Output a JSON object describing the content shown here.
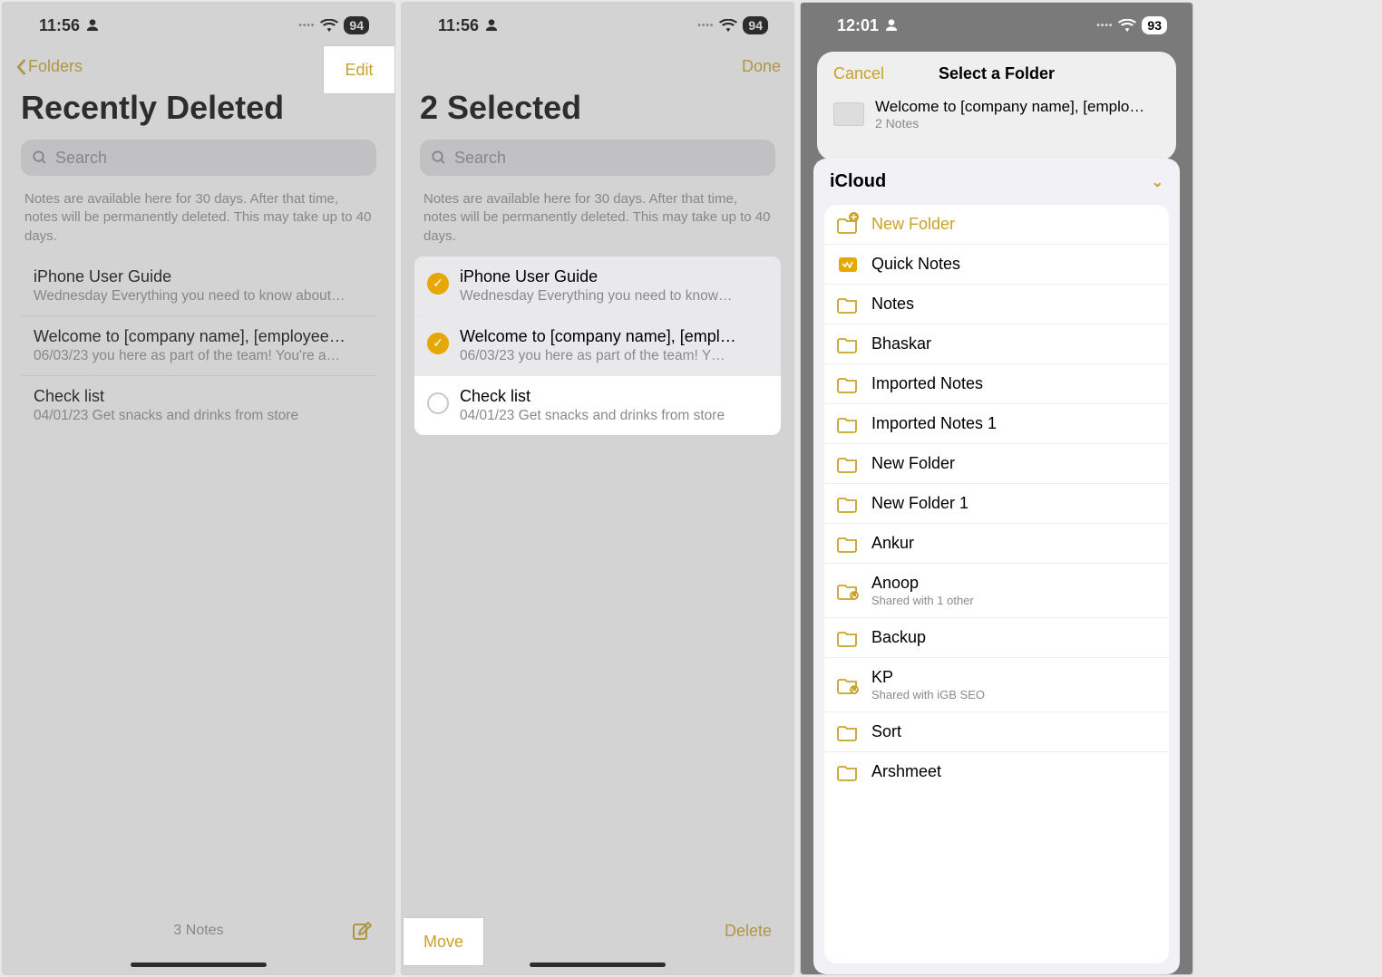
{
  "screen1": {
    "status": {
      "time": "11:56",
      "battery": "94"
    },
    "nav": {
      "back": "Folders",
      "edit": "Edit"
    },
    "title": "Recently Deleted",
    "search_placeholder": "Search",
    "hint": "Notes are available here for 30 days. After that time, notes will be permanently deleted. This may take up to 40 days.",
    "notes": [
      {
        "title": "iPhone User Guide",
        "sub": "Wednesday  Everything you need to know about…"
      },
      {
        "title": "Welcome to [company name], [employee…",
        "sub": "06/03/23  you here as part of the team! You're a…"
      },
      {
        "title": "Check list",
        "sub": "04/01/23  Get snacks and drinks from store"
      }
    ],
    "footer_count": "3 Notes"
  },
  "screen2": {
    "status": {
      "time": "11:56",
      "battery": "94"
    },
    "nav": {
      "done": "Done"
    },
    "title": "2 Selected",
    "search_placeholder": "Search",
    "hint": "Notes are available here for 30 days. After that time, notes will be permanently deleted. This may take up to 40 days.",
    "notes": [
      {
        "title": "iPhone User Guide",
        "sub": "Wednesday  Everything you need to know…",
        "selected": true
      },
      {
        "title": "Welcome to [company name], [empl…",
        "sub": "06/03/23  you here as part of the team! Y…",
        "selected": true
      },
      {
        "title": "Check list",
        "sub": "04/01/23  Get snacks and drinks from store",
        "selected": false
      }
    ],
    "toolbar": {
      "move": "Move",
      "delete": "Delete"
    }
  },
  "screen3": {
    "status": {
      "time": "12:01",
      "battery": "93"
    },
    "cancel": "Cancel",
    "modal_title": "Select a Folder",
    "selection": {
      "title": "Welcome to [company name], [emplo…",
      "sub": "2 Notes"
    },
    "account": "iCloud",
    "new_folder_label": "New Folder",
    "folders": [
      {
        "name": "Quick Notes",
        "type": "quick"
      },
      {
        "name": "Notes",
        "type": "folder"
      },
      {
        "name": "Bhaskar",
        "type": "folder"
      },
      {
        "name": "Imported Notes",
        "type": "folder"
      },
      {
        "name": "Imported Notes 1",
        "type": "folder"
      },
      {
        "name": "New Folder",
        "type": "folder"
      },
      {
        "name": "New Folder 1",
        "type": "folder"
      },
      {
        "name": "Ankur",
        "type": "folder"
      },
      {
        "name": "Anoop",
        "type": "shared",
        "sub": "Shared with 1 other"
      },
      {
        "name": "Backup",
        "type": "folder"
      },
      {
        "name": "KP",
        "type": "shared",
        "sub": "Shared with iGB SEO"
      },
      {
        "name": "Sort",
        "type": "folder"
      },
      {
        "name": "Arshmeet",
        "type": "folder"
      }
    ]
  }
}
